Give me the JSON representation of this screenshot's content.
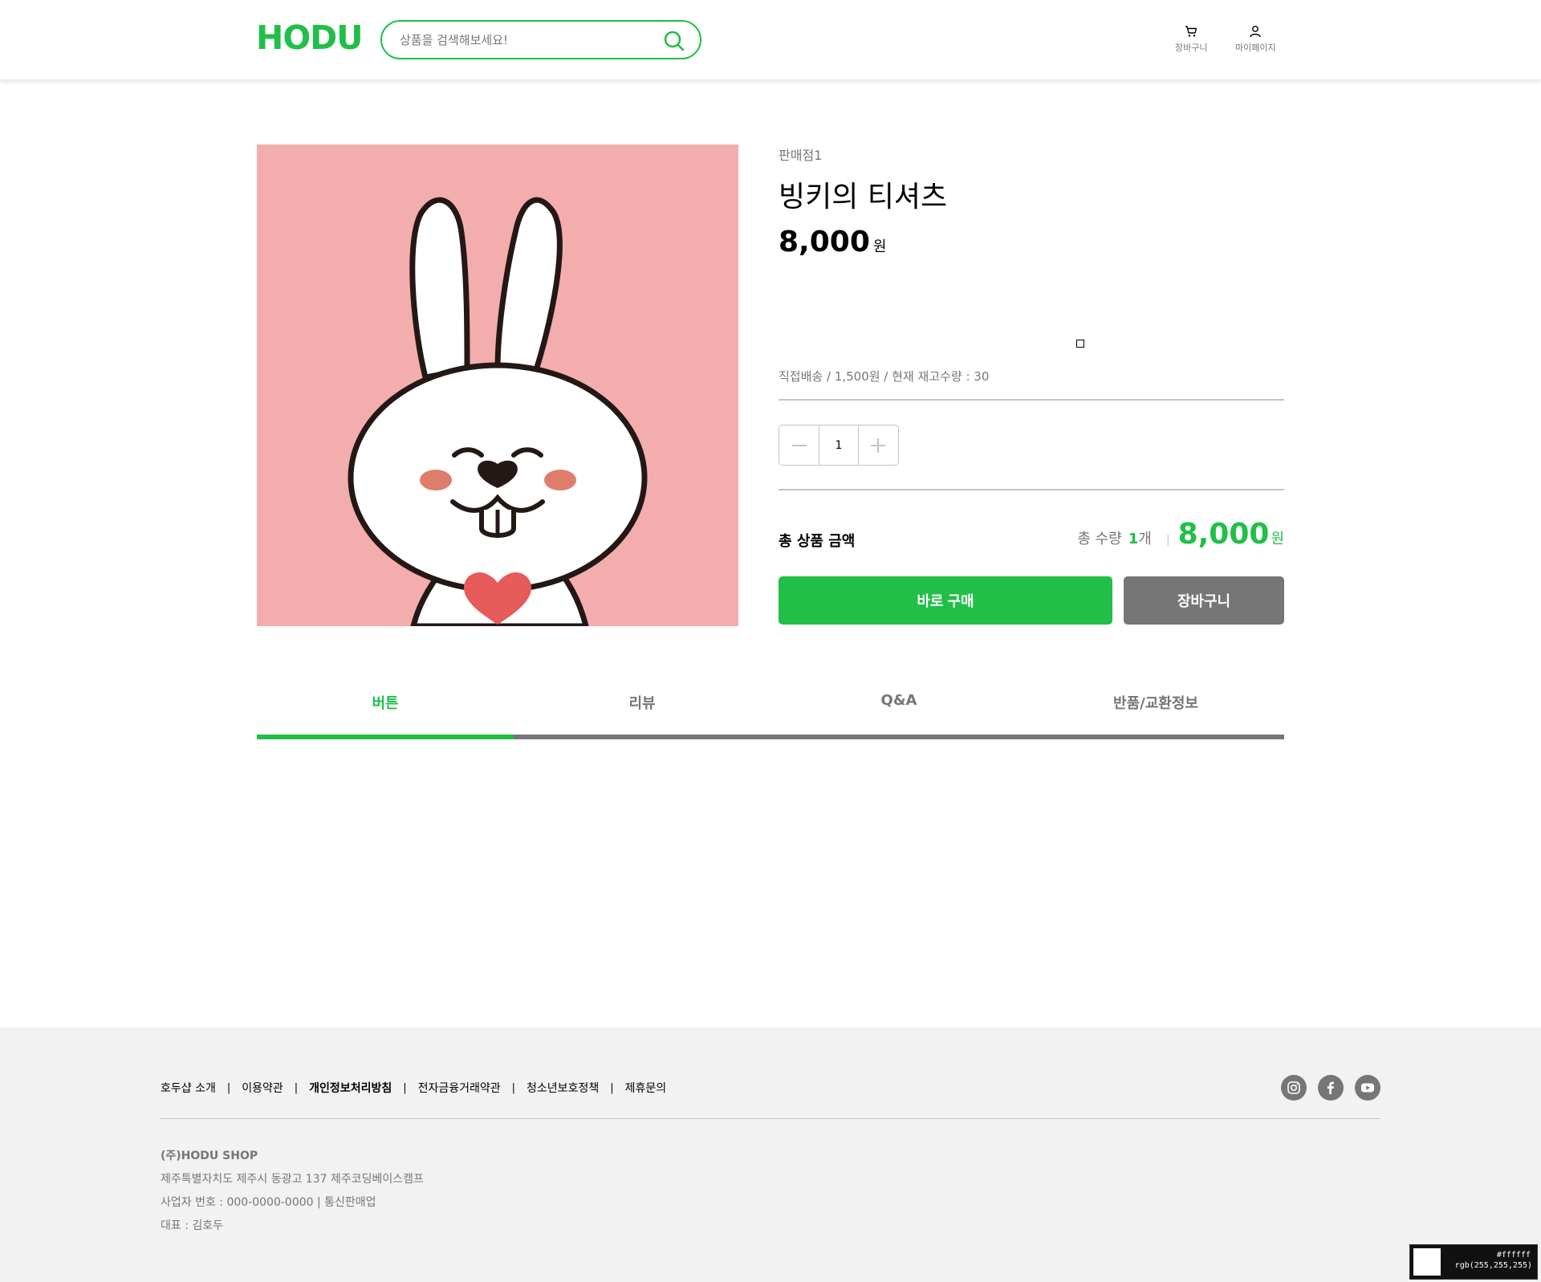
{
  "header": {
    "logo_text": "HODU",
    "search_placeholder": "상품을 검색해보세요!",
    "nav": {
      "cart_label": "장바구니",
      "mypage_label": "마이페이지"
    }
  },
  "product": {
    "seller": "판매점1",
    "name": "빙키의 티셔츠",
    "price": "8,000",
    "price_unit": "원",
    "shipping_info": "직접배송 / 1,500원 / 현재 재고수량 : 30",
    "quantity": "1",
    "total_label": "총 상품 금액",
    "total_qty_label": "총 수량",
    "total_qty": "1",
    "total_qty_unit": "개",
    "total_separator": "|",
    "total_price": "8,000",
    "total_price_unit": "원",
    "buy_label": "바로 구매",
    "cart_label": "장바구니"
  },
  "tabs": [
    {
      "label": "버튼",
      "active": true
    },
    {
      "label": "리뷰",
      "active": false
    },
    {
      "label": "Q&A",
      "active": false
    },
    {
      "label": "반품/교환정보",
      "active": false
    }
  ],
  "footer": {
    "links": [
      {
        "label": "호두샵 소개",
        "bold": false
      },
      {
        "label": "이용약관",
        "bold": false
      },
      {
        "label": "개인정보처리방침",
        "bold": true
      },
      {
        "label": "전자금융거래약관",
        "bold": false
      },
      {
        "label": "청소년보호정책",
        "bold": false
      },
      {
        "label": "제휴문의",
        "bold": false
      }
    ],
    "separator": "|",
    "socials": [
      "instagram-icon",
      "facebook-icon",
      "youtube-icon"
    ],
    "company": "(주)HODU SHOP",
    "address": "제주특별자치도 제주시 동광고 137 제주코딩베이스캠프",
    "business_no": "사업자 번호 : 000-0000-0000 | 통신판매업",
    "ceo": "대표 : 김호두"
  },
  "color_picker": {
    "hex": "#ffffff",
    "rgb": "rgb(255,255,255)"
  },
  "colors": {
    "brand_green": "#21BF48",
    "gray": "#767676",
    "product_bg": "#F3ADAD",
    "footer_bg": "#F2F2F2"
  }
}
